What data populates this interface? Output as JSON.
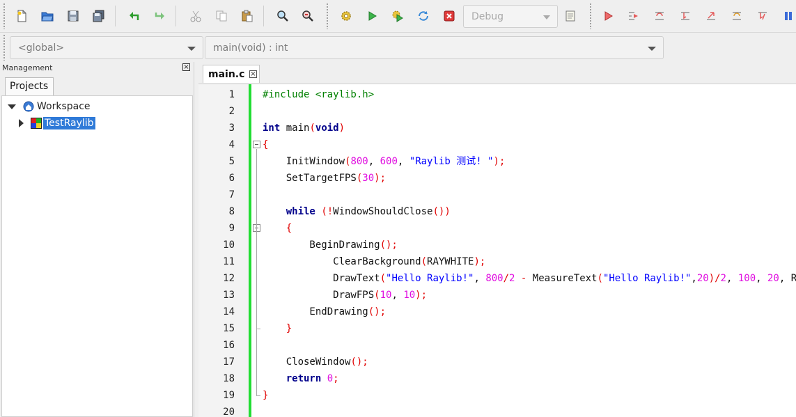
{
  "toolbar": {
    "groups": [
      [
        "new-file",
        "open-file",
        "save-file",
        "save-all"
      ],
      [
        "undo",
        "redo"
      ],
      [
        "cut",
        "copy",
        "paste"
      ],
      [
        "find",
        "replace"
      ],
      [
        "build",
        "run",
        "build-and-run",
        "rebuild",
        "abort"
      ],
      [
        "debug-start",
        "debug-run-to-cursor",
        "debug-next-line",
        "debug-step-into",
        "debug-step-out",
        "debug-next-instruction",
        "debug-step-into-instruction",
        "debug-pause"
      ]
    ],
    "build_target": "Debug"
  },
  "code_completion": {
    "scope": "<global>",
    "function": "main(void) : int"
  },
  "management": {
    "title": "Management",
    "tab": "Projects",
    "workspace_label": "Workspace",
    "project_label": "TestRaylib"
  },
  "editor": {
    "file_tab": "main.c",
    "lines": [
      [
        [
          "pp",
          "#include <raylib.h>"
        ]
      ],
      [],
      [
        [
          "k",
          "int"
        ],
        [
          "",
          " main"
        ],
        [
          "p",
          "("
        ],
        [
          "k",
          "void"
        ],
        [
          "p",
          ")"
        ]
      ],
      [
        [
          "p",
          "{"
        ]
      ],
      [
        [
          "",
          "    InitWindow"
        ],
        [
          "p",
          "("
        ],
        [
          "n",
          "800"
        ],
        [
          "",
          ", "
        ],
        [
          "n",
          "600"
        ],
        [
          "",
          ", "
        ],
        [
          "s",
          "\"Raylib 测试! \""
        ],
        [
          "p",
          ");"
        ]
      ],
      [
        [
          "",
          "    SetTargetFPS"
        ],
        [
          "p",
          "("
        ],
        [
          "n",
          "30"
        ],
        [
          "p",
          ");"
        ]
      ],
      [],
      [
        [
          "",
          "    "
        ],
        [
          "k",
          "while"
        ],
        [
          "",
          " "
        ],
        [
          "p",
          "(!"
        ],
        [
          "",
          "WindowShouldClose"
        ],
        [
          "p",
          "())"
        ]
      ],
      [
        [
          "",
          "    "
        ],
        [
          "p",
          "{"
        ]
      ],
      [
        [
          "",
          "        BeginDrawing"
        ],
        [
          "p",
          "();"
        ]
      ],
      [
        [
          "",
          "            ClearBackground"
        ],
        [
          "p",
          "("
        ],
        [
          "",
          "RAYWHITE"
        ],
        [
          "p",
          ");"
        ]
      ],
      [
        [
          "",
          "            DrawText"
        ],
        [
          "p",
          "("
        ],
        [
          "s",
          "\"Hello Raylib!\""
        ],
        [
          "",
          ", "
        ],
        [
          "n",
          "800"
        ],
        [
          "p",
          "/"
        ],
        [
          "n",
          "2"
        ],
        [
          "",
          " "
        ],
        [
          "p",
          "-"
        ],
        [
          "",
          " MeasureText"
        ],
        [
          "p",
          "("
        ],
        [
          "s",
          "\"Hello Raylib!\""
        ],
        [
          "",
          ","
        ],
        [
          "n",
          "20"
        ],
        [
          "p",
          ")/"
        ],
        [
          "n",
          "2"
        ],
        [
          "",
          ", "
        ],
        [
          "n",
          "100"
        ],
        [
          "",
          ", "
        ],
        [
          "n",
          "20"
        ],
        [
          "",
          ", RED"
        ],
        [
          "p",
          ");"
        ]
      ],
      [
        [
          "",
          "            DrawFPS"
        ],
        [
          "p",
          "("
        ],
        [
          "n",
          "10"
        ],
        [
          "",
          ", "
        ],
        [
          "n",
          "10"
        ],
        [
          "p",
          ");"
        ]
      ],
      [
        [
          "",
          "        EndDrawing"
        ],
        [
          "p",
          "();"
        ]
      ],
      [
        [
          "",
          "    "
        ],
        [
          "p",
          "}"
        ]
      ],
      [],
      [
        [
          "",
          "    CloseWindow"
        ],
        [
          "p",
          "();"
        ]
      ],
      [
        [
          "",
          "    "
        ],
        [
          "k",
          "return"
        ],
        [
          "",
          " "
        ],
        [
          "n",
          "0"
        ],
        [
          "p",
          ";"
        ]
      ],
      [
        [
          "p",
          "}"
        ]
      ],
      []
    ],
    "line_numbers": [
      "1",
      "2",
      "3",
      "4",
      "5",
      "6",
      "7",
      "8",
      "9",
      "10",
      "11",
      "12",
      "13",
      "14",
      "15",
      "16",
      "17",
      "18",
      "19",
      "20"
    ]
  },
  "colors": {
    "keyword": "#00008b",
    "string": "#0000ff",
    "number": "#e00ee0",
    "operator": "#e00000",
    "preprocessor": "#008000",
    "changebar": "#22dd33",
    "selection": "#2f7ad8"
  }
}
